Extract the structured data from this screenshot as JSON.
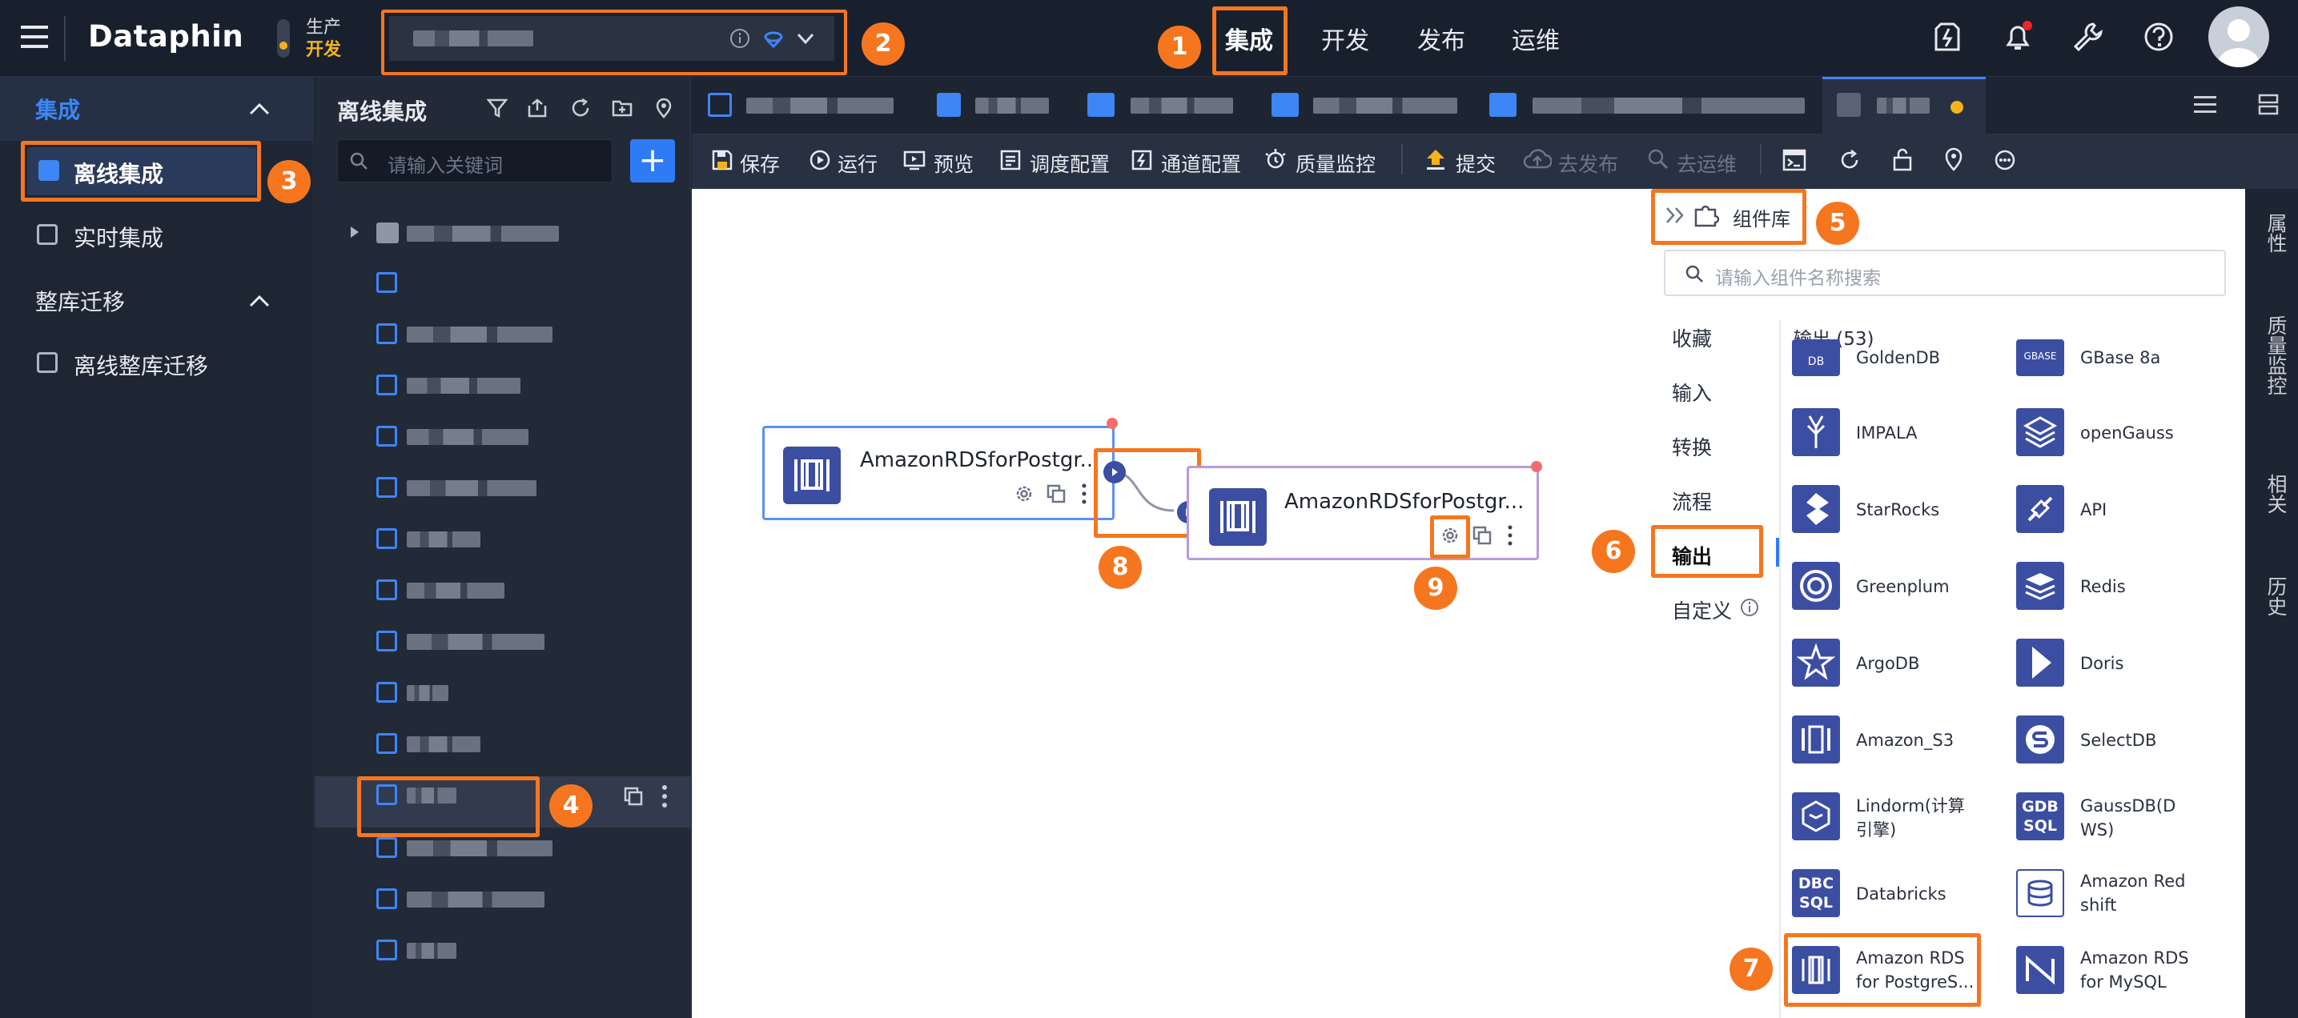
{
  "app": {
    "name": "Dataphin"
  },
  "env": {
    "line1": "生产",
    "line2": "开发"
  },
  "top_nav": [
    {
      "label": "集成"
    },
    {
      "label": "开发"
    },
    {
      "label": "发布"
    },
    {
      "label": "运维"
    }
  ],
  "left_nav": {
    "section1": "集成",
    "items1": [
      {
        "label": "离线集成"
      },
      {
        "label": "实时集成"
      }
    ],
    "section2": "整库迁移",
    "items2": [
      {
        "label": "离线整库迁移"
      }
    ]
  },
  "tree": {
    "title": "离线集成",
    "search_placeholder": "请输入关键词",
    "add_label": "+"
  },
  "toolbar": {
    "save": "保存",
    "run": "运行",
    "preview": "预览",
    "schedule": "调度配置",
    "channel": "通道配置",
    "quality": "质量监控",
    "submit": "提交",
    "publish": "去发布",
    "ops": "去运维"
  },
  "canvas": {
    "node1_title": "AmazonRDSforPostgr...",
    "node2_title": "AmazonRDSforPostgr..."
  },
  "component_panel": {
    "title": "组件库",
    "search_placeholder": "请输入组件名称搜索",
    "categories": [
      {
        "label": "收藏"
      },
      {
        "label": "输入"
      },
      {
        "label": "转换"
      },
      {
        "label": "流程"
      },
      {
        "label": "输出"
      },
      {
        "label": "自定义"
      }
    ],
    "section_title": "输出 (53)",
    "items": [
      {
        "name": "GoldenDB",
        "icon": "goldendb-icon",
        "icon_text": "DB"
      },
      {
        "name": "GBase 8a",
        "icon": "gbase-icon",
        "icon_text": "GBASE"
      },
      {
        "name": "IMPALA",
        "icon": "impala-icon",
        "icon_text": ""
      },
      {
        "name": "openGauss",
        "icon": "opengauss-icon",
        "icon_text": ""
      },
      {
        "name": "StarRocks",
        "icon": "starrocks-icon",
        "icon_text": ""
      },
      {
        "name": "API",
        "icon": "api-icon",
        "icon_text": ""
      },
      {
        "name": "Greenplum",
        "icon": "greenplum-icon",
        "icon_text": ""
      },
      {
        "name": "Redis",
        "icon": "redis-icon",
        "icon_text": ""
      },
      {
        "name": "ArgoDB",
        "icon": "argodb-icon",
        "icon_text": ""
      },
      {
        "name": "Doris",
        "icon": "doris-icon",
        "icon_text": ""
      },
      {
        "name": "Amazon_S3",
        "icon": "amazon-s3-icon",
        "icon_text": ""
      },
      {
        "name": "SelectDB",
        "icon": "selectdb-icon",
        "icon_text": ""
      },
      {
        "name": "Lindorm(计算引擎)",
        "icon": "lindorm-icon",
        "icon_text": ""
      },
      {
        "name": "GaussDB(DWS)",
        "icon": "gaussdb-icon",
        "icon_text": "GDB SQL"
      },
      {
        "name": "Databricks",
        "icon": "databricks-icon",
        "icon_text": "DBC SQL"
      },
      {
        "name": "Amazon Redshift",
        "icon": "redshift-icon",
        "icon_text": ""
      },
      {
        "name": "Amazon RDS for PostgreS...",
        "icon": "amazon-rds-postgres-icon",
        "icon_text": ""
      },
      {
        "name": "Amazon RDS for MySQL",
        "icon": "amazon-rds-mysql-icon",
        "icon_text": ""
      }
    ]
  },
  "right_rail": {
    "items": [
      {
        "label": "属性"
      },
      {
        "label": "质量监控"
      },
      {
        "label": "相关"
      },
      {
        "label": "历史"
      }
    ]
  },
  "badges": [
    "1",
    "2",
    "3",
    "4",
    "5",
    "6",
    "7",
    "8",
    "9"
  ],
  "colors": {
    "accent": "#2f7bf5",
    "highlight": "#f5761f",
    "node_icon": "#3b4ea2",
    "env_dot": "#f5b31b"
  }
}
